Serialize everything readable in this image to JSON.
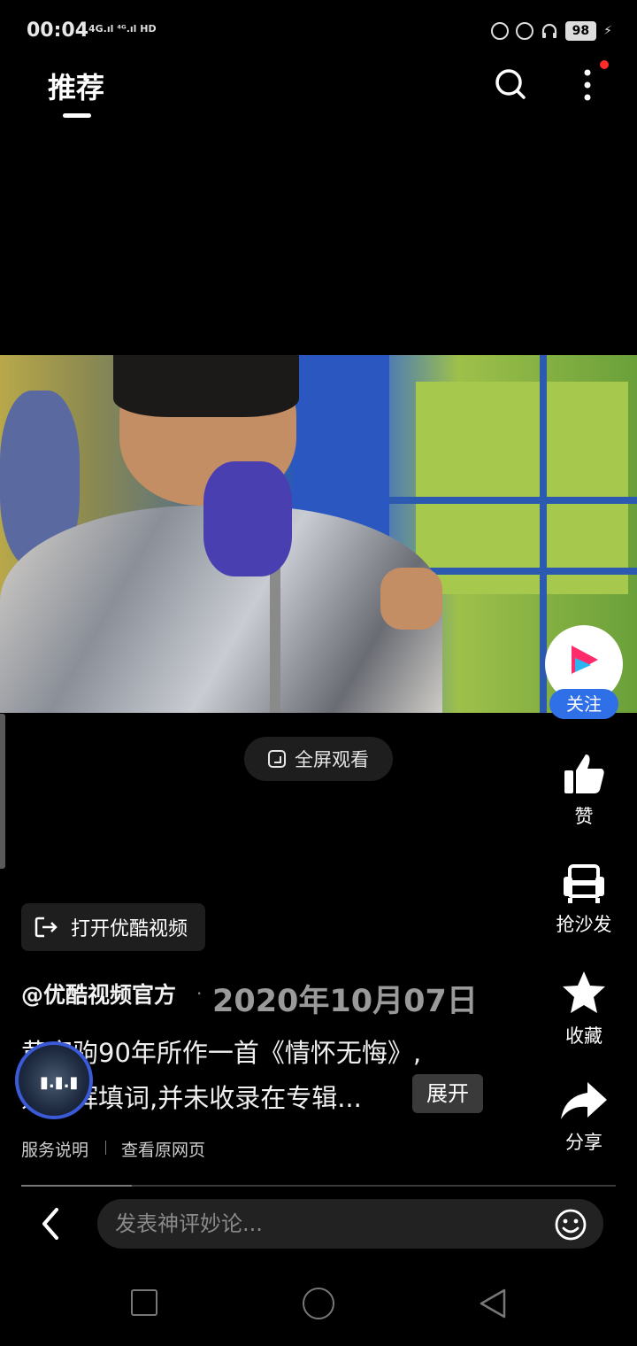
{
  "status_bar": {
    "time": "00:04",
    "signal": "4G.ıl ⁴ᴳ.ıl HD",
    "battery": "98"
  },
  "header": {
    "tab_label": "推荐",
    "icons": [
      "search-icon",
      "more-vertical-icon"
    ]
  },
  "video": {
    "fullscreen_label": "全屏观看"
  },
  "right_actions": {
    "follow_label": "关注",
    "like_label": "赞",
    "sofa_label": "抢沙发",
    "collect_label": "收藏",
    "share_label": "分享"
  },
  "open_app_label": "打开优酷视频",
  "post": {
    "author": "@优酷视频官方",
    "separator": "·",
    "date": "2020年10月07日",
    "desc_line1": "黄家驹90年所作一首《情怀无悔》,",
    "desc_line2": "刘卓辉填词,并未收录在专辑...",
    "expand_label": "展开"
  },
  "footer_links": {
    "service": "服务说明",
    "view_original": "查看原网页"
  },
  "comment": {
    "placeholder": "发表神评妙论..."
  },
  "colors": {
    "accent": "#2f6fe8",
    "background": "#000000",
    "notification": "#ff2a2a"
  }
}
